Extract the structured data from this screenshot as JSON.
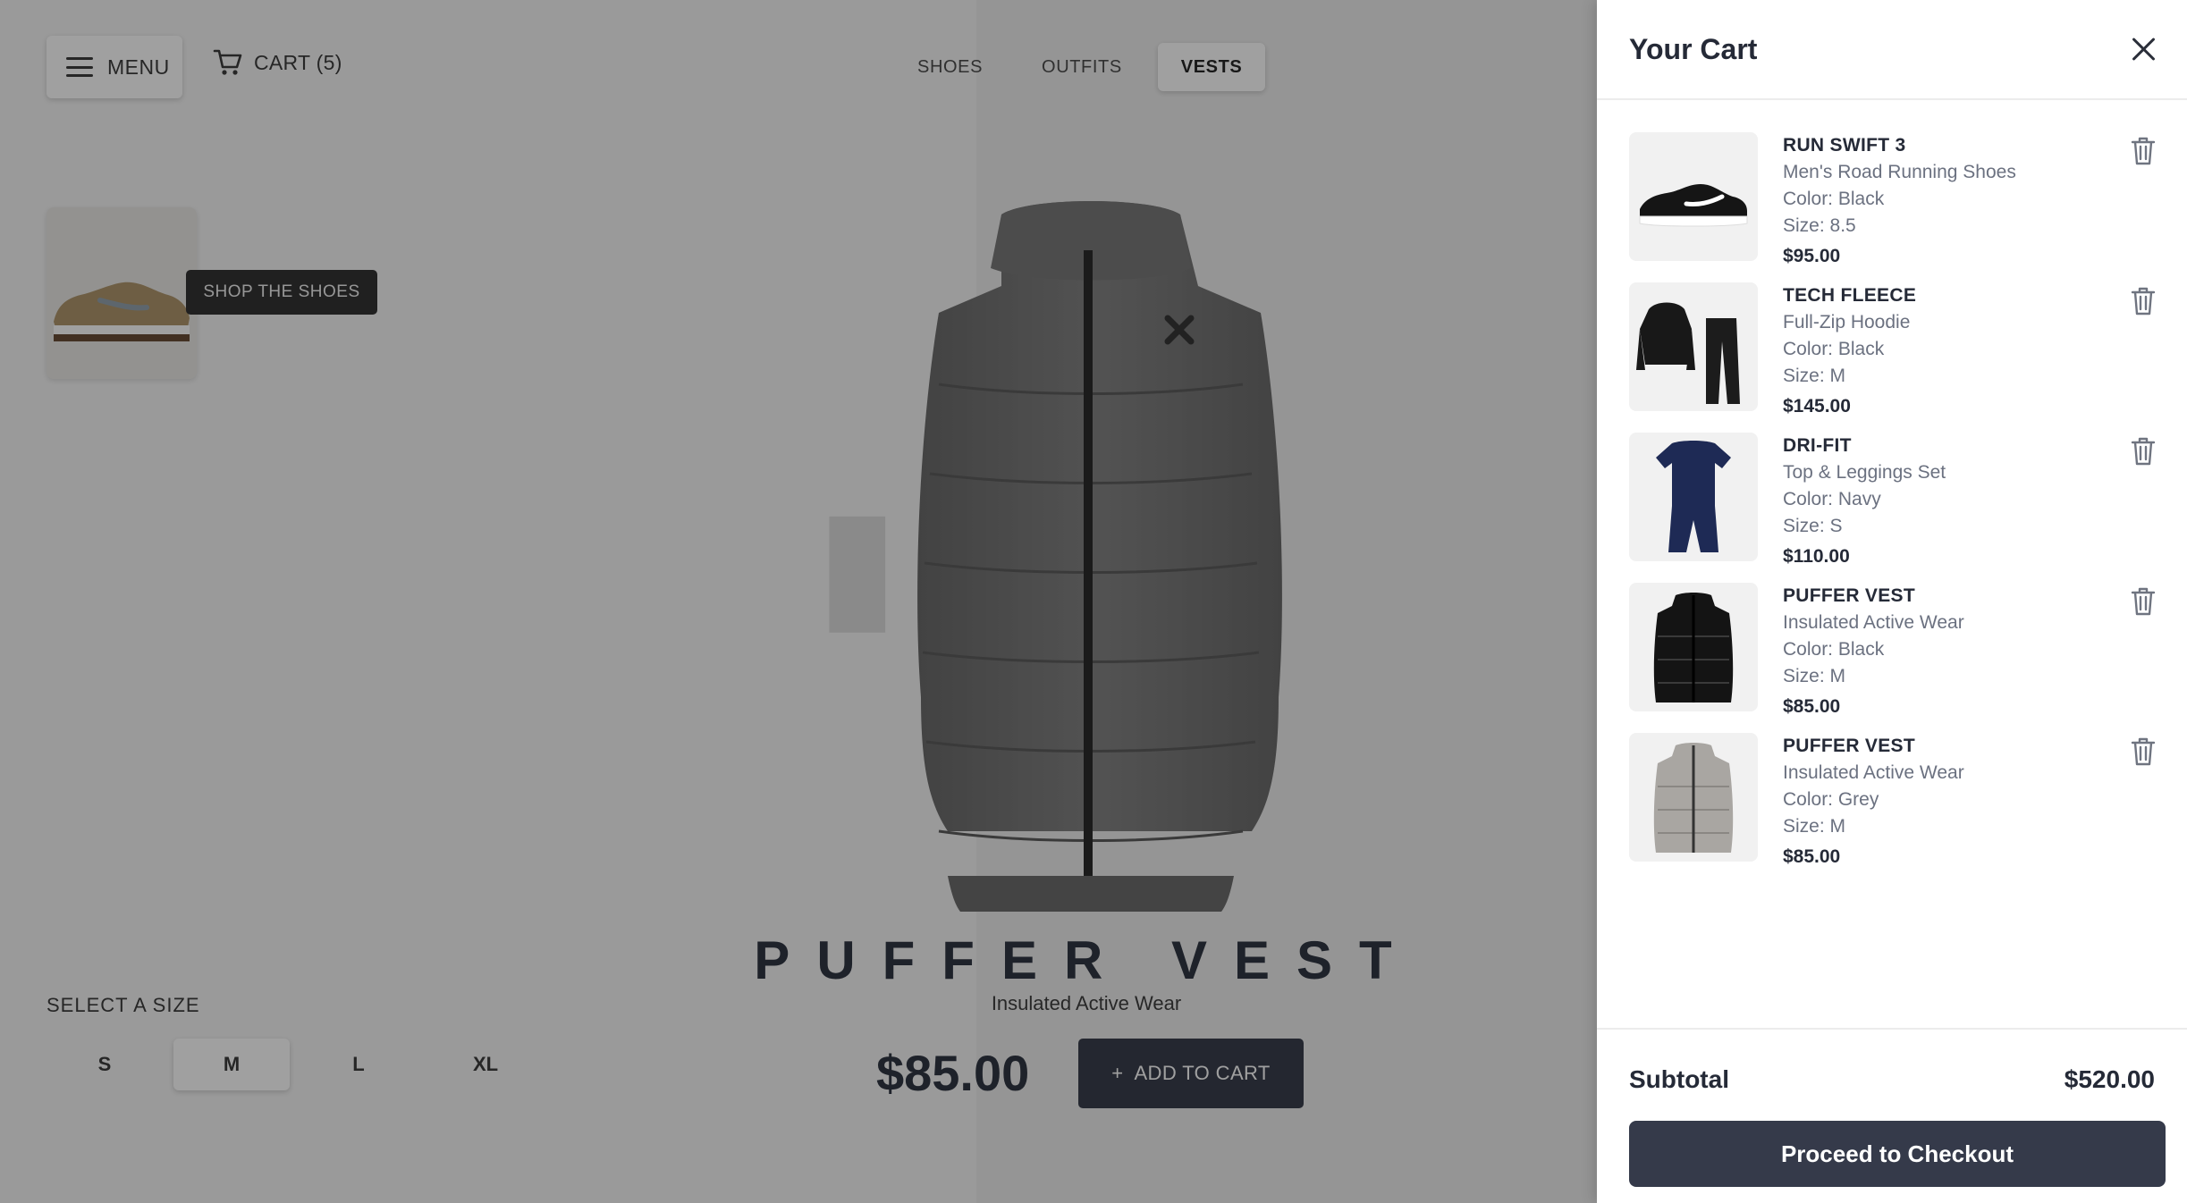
{
  "header": {
    "menu_label": "MENU",
    "cart_label": "CART (5)",
    "nav": [
      "SHOES",
      "OUTFITS",
      "VESTS"
    ],
    "active_nav": "VESTS"
  },
  "promo": {
    "tag": "SHOP THE SHOES"
  },
  "product": {
    "title": "PUFFER VEST",
    "subtitle": "Insulated Active Wear",
    "price": "$85.00",
    "add_to_cart": "ADD TO CART",
    "add_icon": "+"
  },
  "sizes": {
    "label": "SELECT A SIZE",
    "options": [
      "S",
      "M",
      "L",
      "XL"
    ],
    "selected": "M"
  },
  "cart": {
    "title": "Your Cart",
    "items": [
      {
        "name": "RUN SWIFT 3",
        "desc": "Men's Road Running Shoes",
        "color": "Color: Black",
        "size": "Size: 8.5",
        "price": "$95.00"
      },
      {
        "name": "TECH FLEECE",
        "desc": "Full-Zip Hoodie",
        "color": "Color: Black",
        "size": "Size: M",
        "price": "$145.00"
      },
      {
        "name": "DRI-FIT",
        "desc": "Top & Leggings Set",
        "color": "Color: Navy",
        "size": "Size: S",
        "price": "$110.00"
      },
      {
        "name": "PUFFER VEST",
        "desc": "Insulated Active Wear",
        "color": "Color: Black",
        "size": "Size: M",
        "price": "$85.00"
      },
      {
        "name": "PUFFER VEST",
        "desc": "Insulated Active Wear",
        "color": "Color: Grey",
        "size": "Size: M",
        "price": "$85.00"
      }
    ],
    "subtotal_label": "Subtotal",
    "subtotal_value": "$520.00",
    "checkout_label": "Proceed to Checkout"
  },
  "colors": {
    "dark_navy": "#262b3a",
    "checkout": "#353a4a",
    "overlay": "rgba(35,35,35,0.43)"
  }
}
